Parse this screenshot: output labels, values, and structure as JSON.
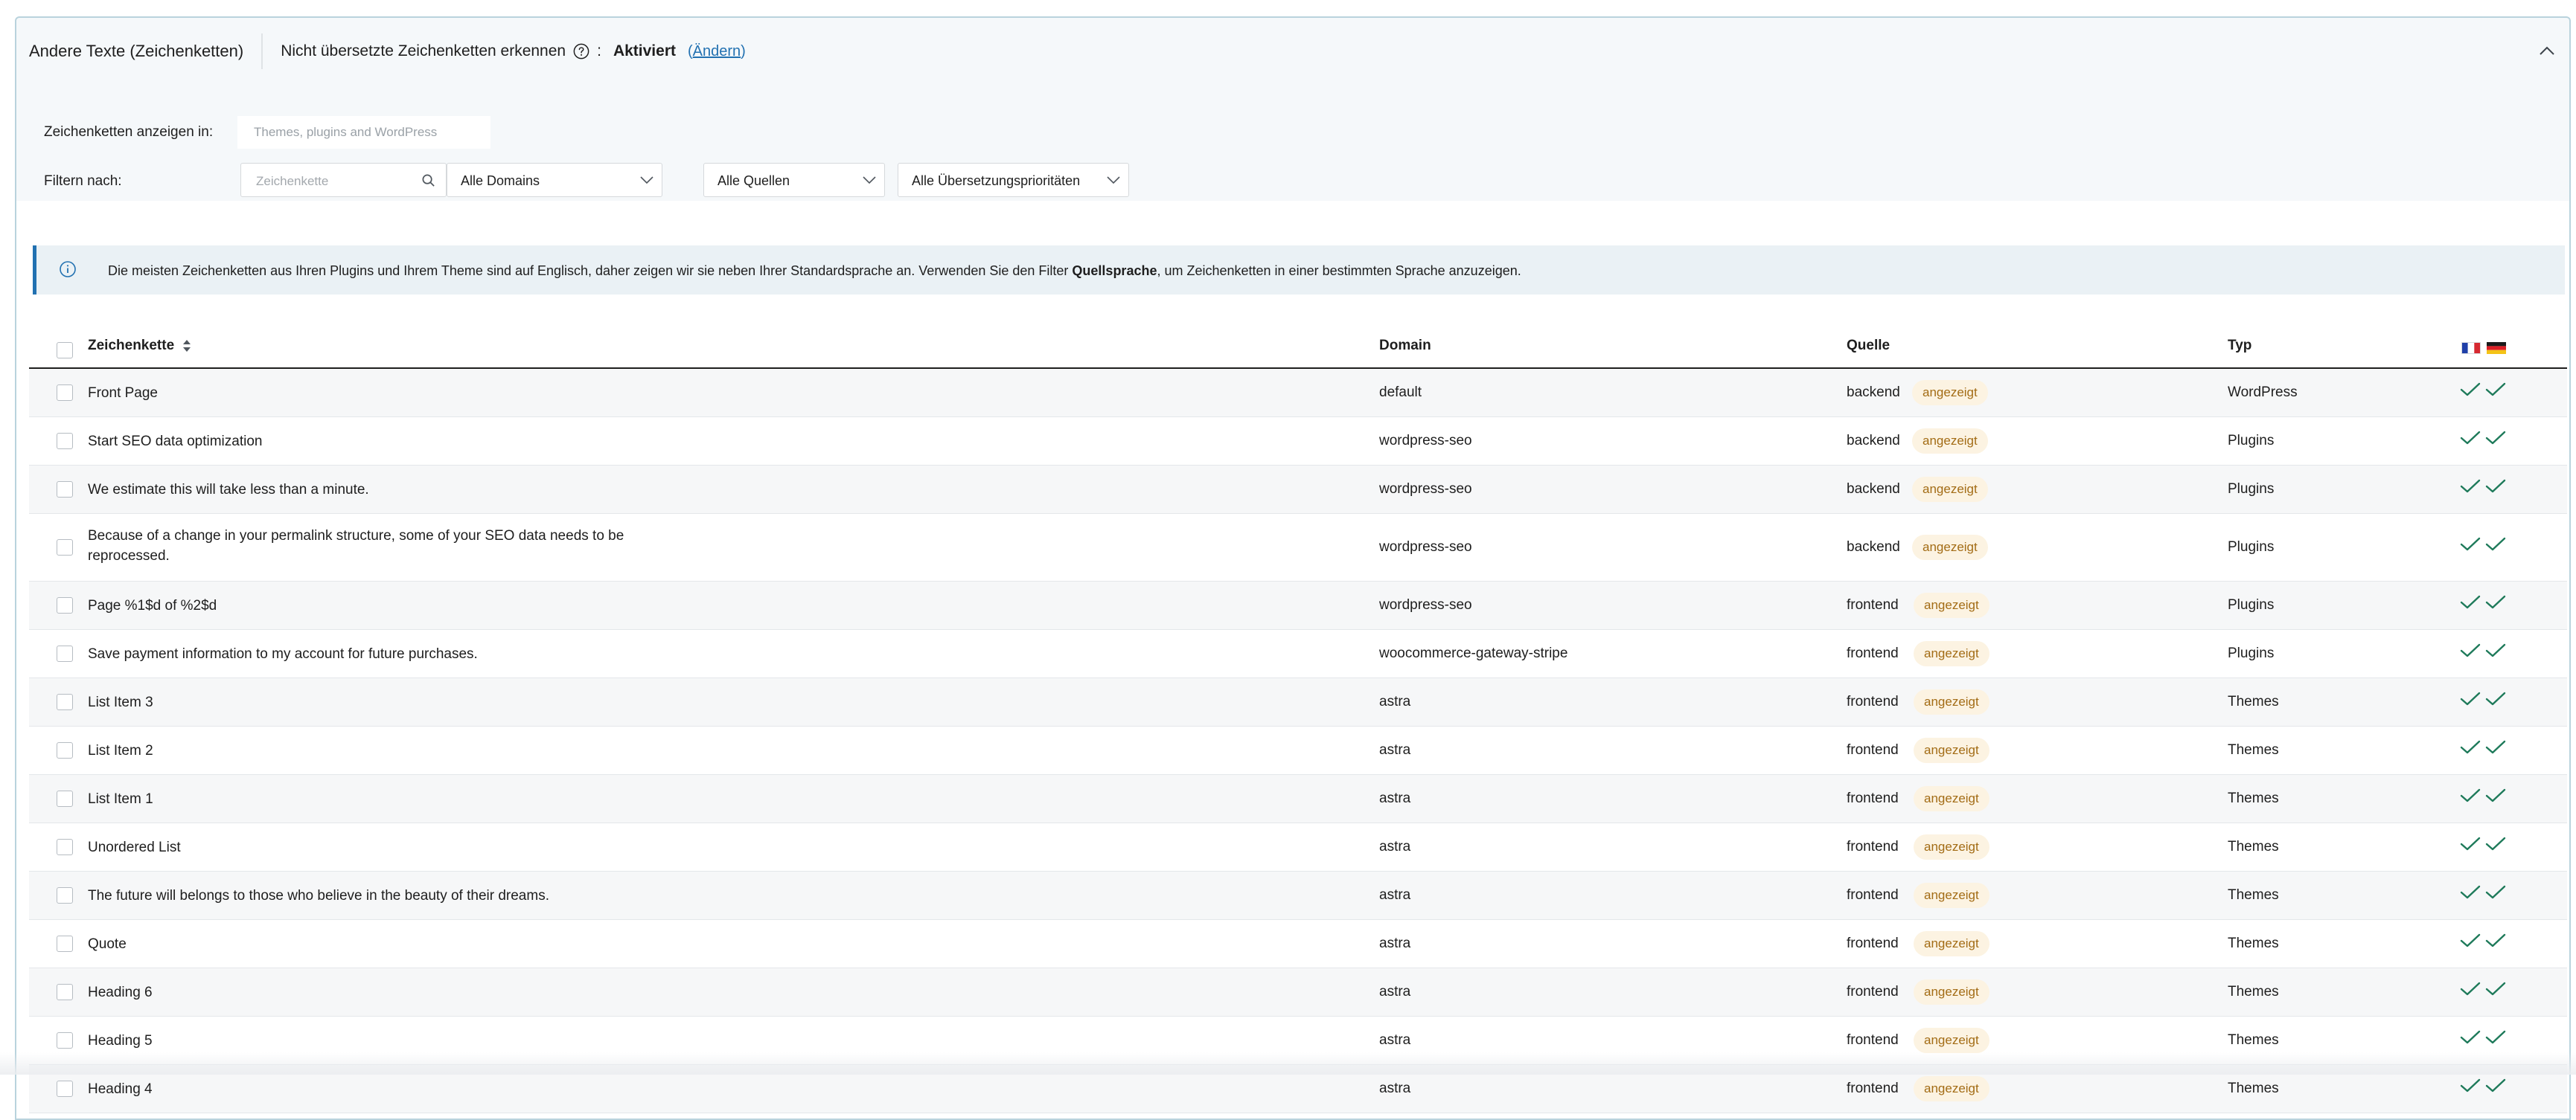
{
  "header": {
    "title": "Andere Texte (Zeichenketten)",
    "detect_label": "Nicht übersetzte Zeichenketten erkennen",
    "colon": ":",
    "status": "Aktiviert",
    "paren_open": "(",
    "change_link": "Ändern",
    "paren_close": ")"
  },
  "filters": {
    "show_label": "Zeichenketten anzeigen in:",
    "show_placeholder": "Themes, plugins and WordPress",
    "filter_label": "Filtern nach:",
    "search_placeholder": "Zeichenkette",
    "domain_select": "Alle Domains",
    "source_select": "Alle Quellen",
    "priority_select": "Alle Übersetzungsprioritäten"
  },
  "notice": {
    "text_before": "Die meisten Zeichenketten aus Ihren Plugins und Ihrem Theme sind auf Englisch, daher zeigen wir sie neben Ihrer Standardsprache an. Verwenden Sie den Filter ",
    "text_bold": "Quellsprache",
    "text_after": ", um Zeichenketten in einer bestimmten Sprache anzuzeigen."
  },
  "table": {
    "columns": {
      "string": "Zeichenkette",
      "domain": "Domain",
      "source": "Quelle",
      "type": "Typ"
    },
    "badge_label": "angezeigt",
    "rows": [
      {
        "string": "Front Page",
        "domain": "default",
        "source": "backend",
        "type": "WordPress"
      },
      {
        "string": "Start SEO data optimization",
        "domain": "wordpress-seo",
        "source": "backend",
        "type": "Plugins"
      },
      {
        "string": "We estimate this will take less than a minute.",
        "domain": "wordpress-seo",
        "source": "backend",
        "type": "Plugins"
      },
      {
        "string": "Because of a change in your permalink structure, some of your SEO data needs to be reprocessed.",
        "domain": "wordpress-seo",
        "source": "backend",
        "type": "Plugins"
      },
      {
        "string": "Page %1$d of %2$d",
        "domain": "wordpress-seo",
        "source": "frontend",
        "type": "Plugins"
      },
      {
        "string": "Save payment information to my account for future purchases.",
        "domain": "woocommerce-gateway-stripe",
        "source": "frontend",
        "type": "Plugins"
      },
      {
        "string": "List Item 3",
        "domain": "astra",
        "source": "frontend",
        "type": "Themes"
      },
      {
        "string": "List Item 2",
        "domain": "astra",
        "source": "frontend",
        "type": "Themes"
      },
      {
        "string": "List Item 1",
        "domain": "astra",
        "source": "frontend",
        "type": "Themes"
      },
      {
        "string": "Unordered List",
        "domain": "astra",
        "source": "frontend",
        "type": "Themes"
      },
      {
        "string": "The future will belongs to those who believe in the beauty of their dreams.",
        "domain": "astra",
        "source": "frontend",
        "type": "Themes"
      },
      {
        "string": "Quote",
        "domain": "astra",
        "source": "frontend",
        "type": "Themes"
      },
      {
        "string": "Heading 6",
        "domain": "astra",
        "source": "frontend",
        "type": "Themes"
      },
      {
        "string": "Heading 5",
        "domain": "astra",
        "source": "frontend",
        "type": "Themes"
      },
      {
        "string": "Heading 4",
        "domain": "astra",
        "source": "frontend",
        "type": "Themes"
      }
    ]
  },
  "colors": {
    "accent": "#2271b1",
    "check": "#1e7a5a",
    "badge_bg": "#fcf3e2",
    "badge_text": "#a36c15"
  },
  "icons": {
    "help": "help-circle-icon",
    "collapse": "chevron-up-icon",
    "search": "search-icon",
    "info": "info-icon",
    "sort": "sort-icon",
    "check": "checkmark-icon",
    "flag_fr": "flag-fr-icon",
    "flag_de": "flag-de-icon"
  }
}
